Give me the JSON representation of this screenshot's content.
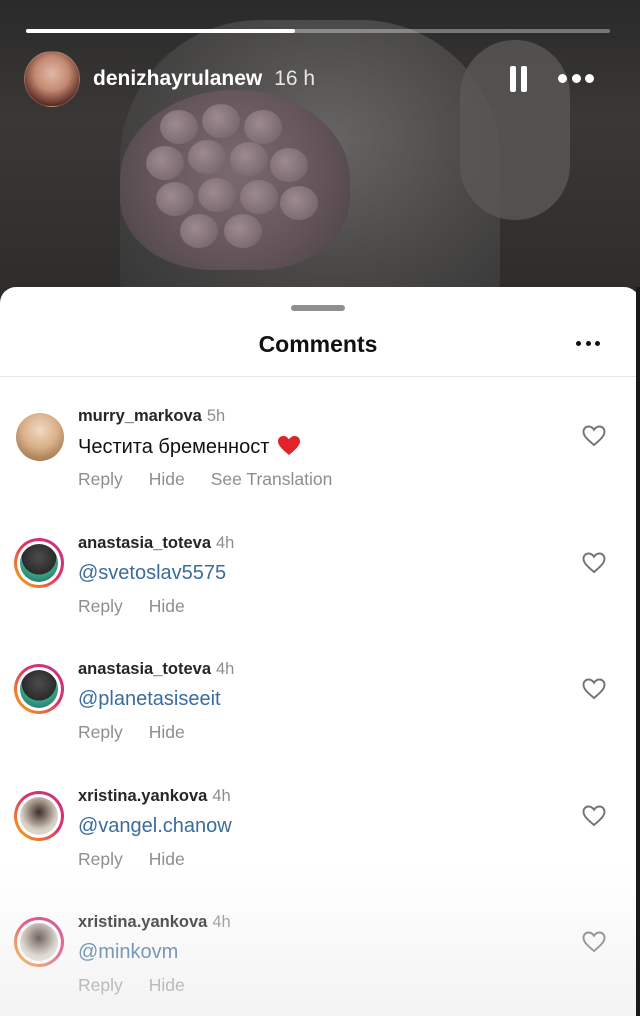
{
  "story": {
    "username": "denizhayrulanew",
    "time": "16 h",
    "progress": 0.46
  },
  "sheet": {
    "title": "Comments"
  },
  "comments": [
    {
      "username": "murry_markova",
      "time": "5h",
      "text": "Честита бременност",
      "emoji": "red-heart",
      "is_mention": false,
      "actions": [
        "Reply",
        "Hide",
        "See Translation"
      ]
    },
    {
      "username": "anastasia_toteva",
      "time": "4h",
      "text": "@svetoslav5575",
      "is_mention": true,
      "actions": [
        "Reply",
        "Hide"
      ]
    },
    {
      "username": "anastasia_toteva",
      "time": "4h",
      "text": "@planetasiseeit",
      "is_mention": true,
      "actions": [
        "Reply",
        "Hide"
      ]
    },
    {
      "username": "xristina.yankova",
      "time": "4h",
      "text": "@vangel.chanow",
      "is_mention": true,
      "actions": [
        "Reply",
        "Hide"
      ]
    },
    {
      "username": "xristina.yankova",
      "time": "4h",
      "text": "@minkovm",
      "is_mention": true,
      "actions": [
        "Reply",
        "Hide"
      ]
    }
  ]
}
